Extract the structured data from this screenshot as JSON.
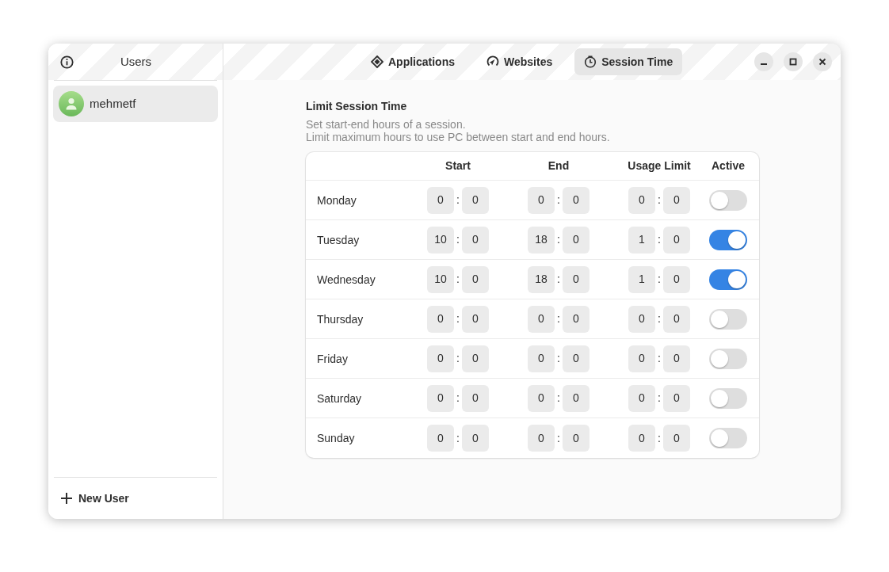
{
  "sidebar": {
    "title": "Users",
    "users": [
      {
        "name": "mehmetf",
        "selected": true
      }
    ],
    "add_button": "New User"
  },
  "tabs": [
    {
      "label": "Applications",
      "selected": false
    },
    {
      "label": "Websites",
      "selected": false
    },
    {
      "label": "Session Time",
      "selected": true
    }
  ],
  "section": {
    "title": "Limit Session Time",
    "description": [
      "Set start-end hours of a session.",
      "Limit maximum hours to use PC between start and end hours."
    ]
  },
  "table": {
    "columns": [
      "Start",
      "End",
      "Usage Limit",
      "Active"
    ],
    "rows": [
      {
        "day": "Monday",
        "start": {
          "hours": "0",
          "separator": ":",
          "minutes": "0"
        },
        "end": {
          "hours": "0",
          "separator": ":",
          "minutes": "0"
        },
        "limit": {
          "hours": "0",
          "separator": ":",
          "minutes": "0"
        },
        "active": false
      },
      {
        "day": "Tuesday",
        "start": {
          "hours": "10",
          "separator": ":",
          "minutes": "0"
        },
        "end": {
          "hours": "18",
          "separator": ":",
          "minutes": "0"
        },
        "limit": {
          "hours": "1",
          "separator": ":",
          "minutes": "0"
        },
        "active": true
      },
      {
        "day": "Wednesday",
        "start": {
          "hours": "10",
          "separator": ":",
          "minutes": "0"
        },
        "end": {
          "hours": "18",
          "separator": ":",
          "minutes": "0"
        },
        "limit": {
          "hours": "1",
          "separator": ":",
          "minutes": "0"
        },
        "active": true
      },
      {
        "day": "Thursday",
        "start": {
          "hours": "0",
          "separator": ":",
          "minutes": "0"
        },
        "end": {
          "hours": "0",
          "separator": ":",
          "minutes": "0"
        },
        "limit": {
          "hours": "0",
          "separator": ":",
          "minutes": "0"
        },
        "active": false
      },
      {
        "day": "Friday",
        "start": {
          "hours": "0",
          "separator": ":",
          "minutes": "0"
        },
        "end": {
          "hours": "0",
          "separator": ":",
          "minutes": "0"
        },
        "limit": {
          "hours": "0",
          "separator": ":",
          "minutes": "0"
        },
        "active": false
      },
      {
        "day": "Saturday",
        "start": {
          "hours": "0",
          "separator": ":",
          "minutes": "0"
        },
        "end": {
          "hours": "0",
          "separator": ":",
          "minutes": "0"
        },
        "limit": {
          "hours": "0",
          "separator": ":",
          "minutes": "0"
        },
        "active": false
      },
      {
        "day": "Sunday",
        "start": {
          "hours": "0",
          "separator": ":",
          "minutes": "0"
        },
        "end": {
          "hours": "0",
          "separator": ":",
          "minutes": "0"
        },
        "limit": {
          "hours": "0",
          "separator": ":",
          "minutes": "0"
        },
        "active": false
      }
    ]
  }
}
